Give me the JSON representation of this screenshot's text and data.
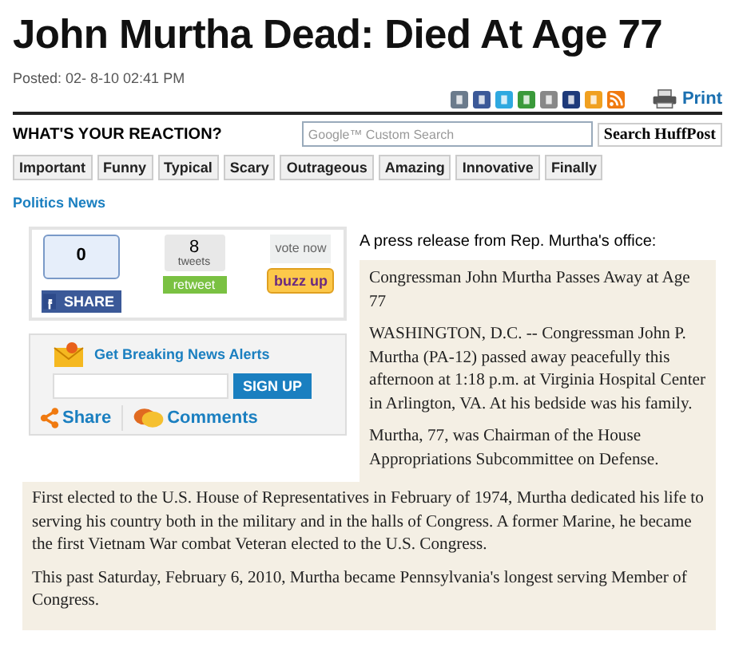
{
  "headline": "John Murtha Dead: Died At Age 77",
  "posted": "Posted: 02- 8-10 02:41 PM",
  "print_link": "Print",
  "reaction": {
    "title": "WHAT'S YOUR REACTION?",
    "buttons": [
      "Important",
      "Funny",
      "Typical",
      "Scary",
      "Outrageous",
      "Amazing",
      "Innovative",
      "Finally"
    ]
  },
  "search": {
    "placeholder": "Google™ Custom Search",
    "button": "Search HuffPost"
  },
  "section": "Politics News",
  "share_widget": {
    "like_count": "0",
    "share_button": "SHARE",
    "tweet_count": "8",
    "tweet_unit": "tweets",
    "retweet_button": "retweet",
    "vote_label": "vote now",
    "buzz_button": "buzz up"
  },
  "alerts": {
    "title": "Get Breaking News Alerts",
    "signup_button": "SIGN UP",
    "share_link": "Share",
    "comments_link": "Comments"
  },
  "intro": "A press release from Rep. Murtha's office:",
  "release_title": "Congressman John Murtha Passes Away at Age 77",
  "release_paragraphs": [
    "WASHINGTON, D.C. -- Congressman John P. Murtha (PA-12) passed away peacefully this afternoon at 1:18 p.m. at Virginia Hospital Center in Arlington, VA. At his bedside was his family.",
    "Murtha, 77, was Chairman of the House Appropriations Subcommittee on Defense.",
    "First elected to the U.S. House of Representatives in February of 1974, Murtha dedicated his life to serving his country both in the military and in the halls of Congress. A former Marine, he became the first Vietnam War combat Veteran elected to the U.S. Congress.",
    "This past Saturday, February 6, 2010, Murtha became Pennsylvania's longest serving Member of Congress."
  ]
}
